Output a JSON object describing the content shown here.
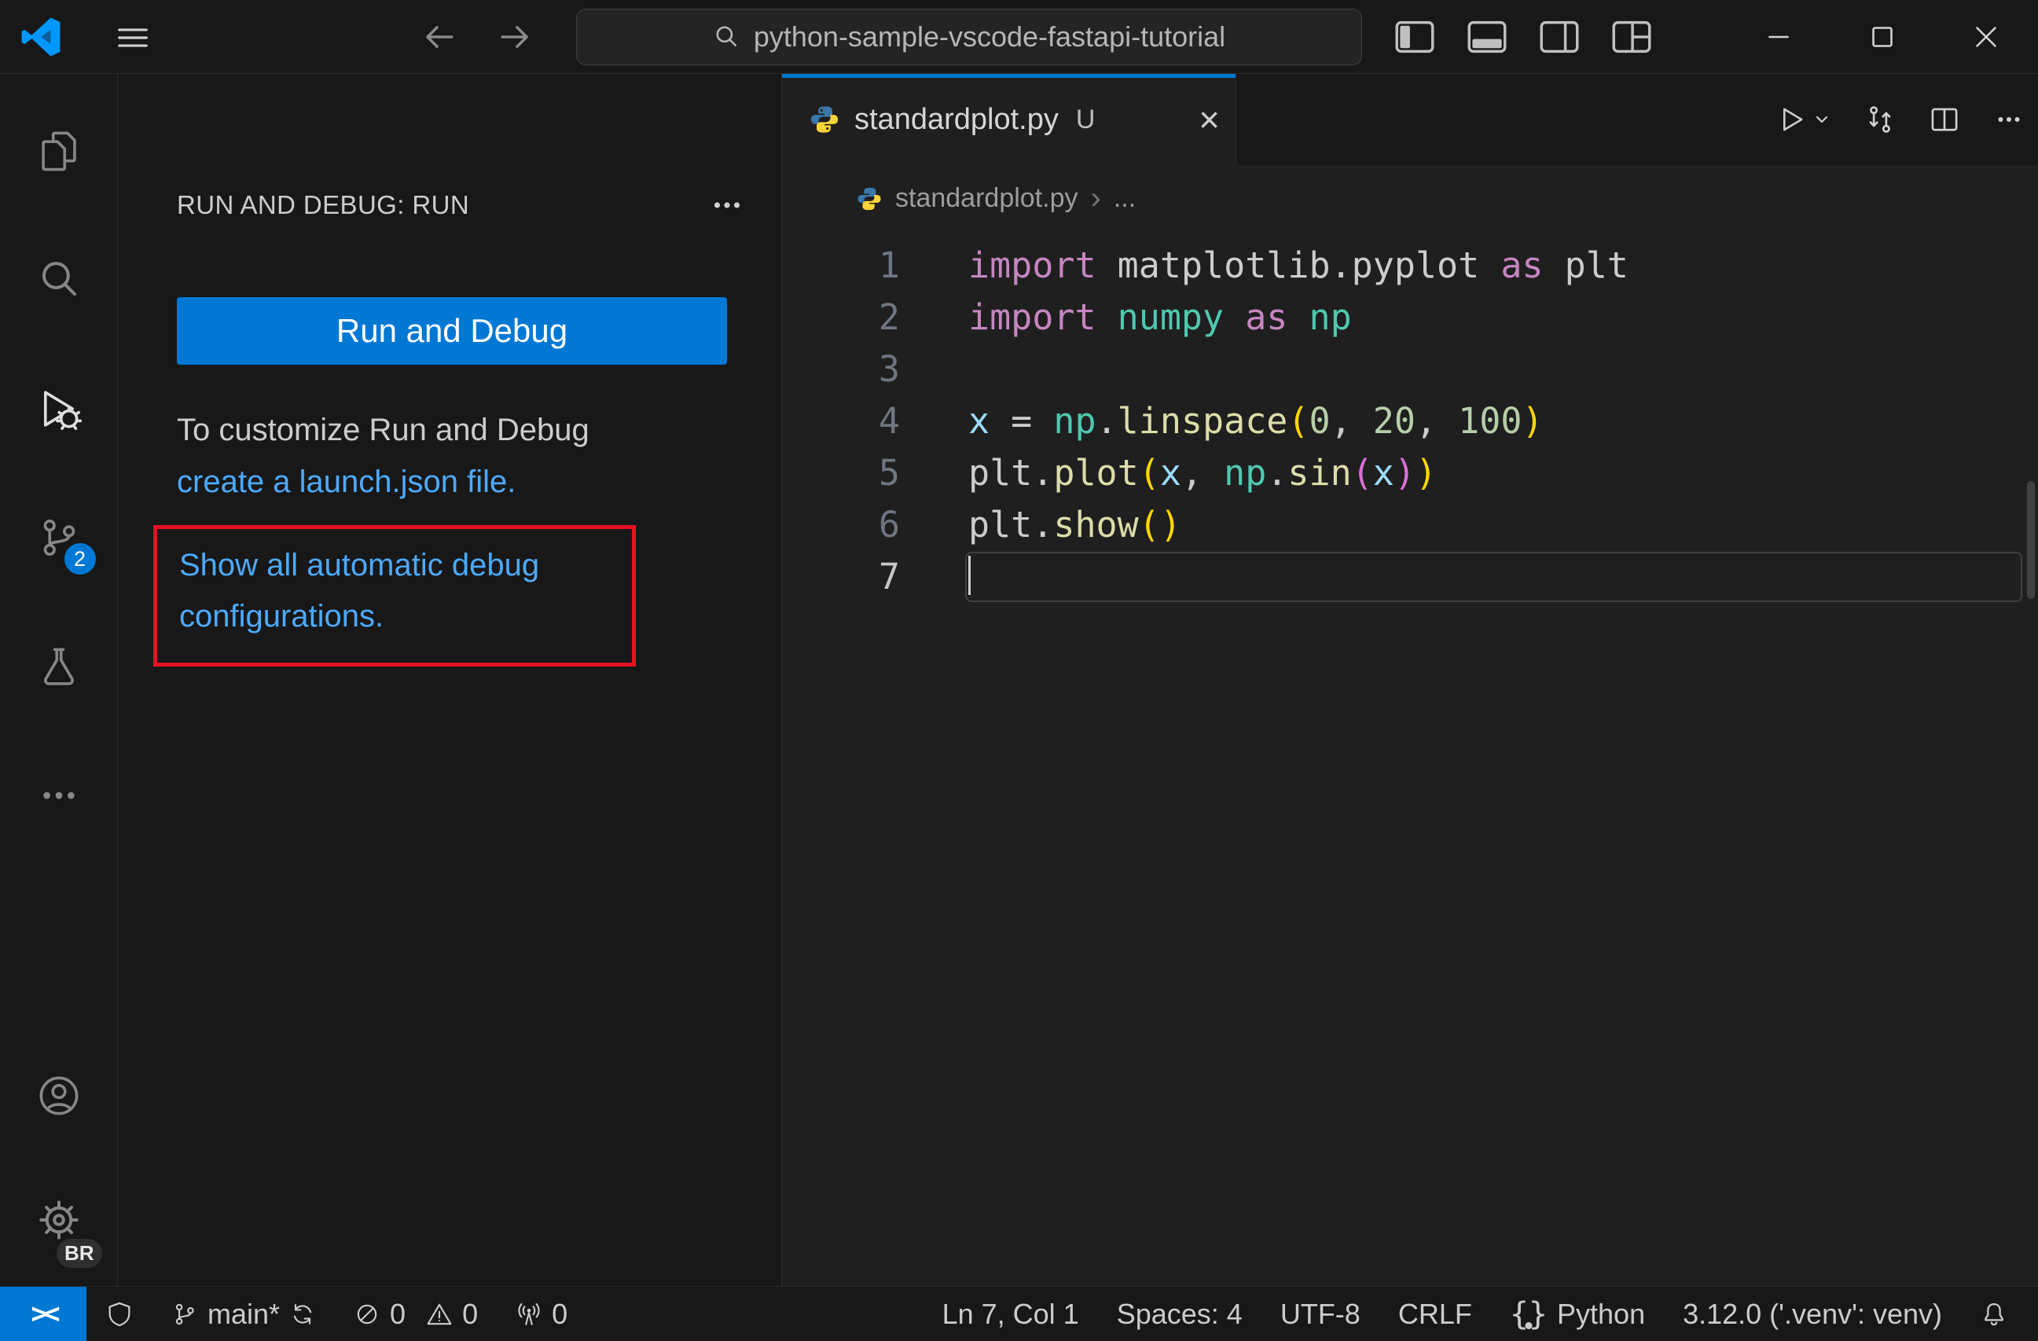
{
  "colors": {
    "accent": "#0078d4",
    "link": "#4daafc",
    "annotation": "#e81123"
  },
  "titlebar": {
    "command_center_text": "python-sample-vscode-fastapi-tutorial"
  },
  "activity_bar": {
    "scm_badge": "2",
    "profile_badge": "BR"
  },
  "sidebar": {
    "header": "RUN AND DEBUG: RUN",
    "run_button_label": "Run and Debug",
    "customize_text": "To customize Run and Debug",
    "customize_link": "create a launch.json file.",
    "show_configs_link": "Show all automatic debug configurations."
  },
  "editor": {
    "tab": {
      "title": "standardplot.py",
      "git_status": "U"
    },
    "breadcrumb": {
      "file": "standardplot.py",
      "more": "..."
    },
    "lines": [
      {
        "n": "1",
        "tokens": [
          {
            "t": "import",
            "c": "kw"
          },
          {
            "t": " matplotlib.pyplot ",
            "c": "fg"
          },
          {
            "t": "as",
            "c": "kw"
          },
          {
            "t": " plt",
            "c": "fg"
          }
        ]
      },
      {
        "n": "2",
        "tokens": [
          {
            "t": "import",
            "c": "kw"
          },
          {
            "t": " numpy ",
            "c": "mod"
          },
          {
            "t": "as",
            "c": "kw"
          },
          {
            "t": " np",
            "c": "mod"
          }
        ]
      },
      {
        "n": "3",
        "tokens": []
      },
      {
        "n": "4",
        "tokens": [
          {
            "t": "x",
            "c": "var"
          },
          {
            "t": " = ",
            "c": "fg"
          },
          {
            "t": "np",
            "c": "mod"
          },
          {
            "t": ".",
            "c": "fg"
          },
          {
            "t": "linspace",
            "c": "fn"
          },
          {
            "t": "(",
            "c": "b1"
          },
          {
            "t": "0",
            "c": "num"
          },
          {
            "t": ", ",
            "c": "fg"
          },
          {
            "t": "20",
            "c": "num"
          },
          {
            "t": ", ",
            "c": "fg"
          },
          {
            "t": "100",
            "c": "num"
          },
          {
            "t": ")",
            "c": "b1"
          }
        ]
      },
      {
        "n": "5",
        "tokens": [
          {
            "t": "plt",
            "c": "fg"
          },
          {
            "t": ".",
            "c": "fg"
          },
          {
            "t": "plot",
            "c": "fn"
          },
          {
            "t": "(",
            "c": "b1"
          },
          {
            "t": "x",
            "c": "var"
          },
          {
            "t": ", ",
            "c": "fg"
          },
          {
            "t": "np",
            "c": "mod"
          },
          {
            "t": ".",
            "c": "fg"
          },
          {
            "t": "sin",
            "c": "fn"
          },
          {
            "t": "(",
            "c": "b2"
          },
          {
            "t": "x",
            "c": "var"
          },
          {
            "t": ")",
            "c": "b2"
          },
          {
            "t": ")",
            "c": "b1"
          }
        ]
      },
      {
        "n": "6",
        "tokens": [
          {
            "t": "plt",
            "c": "fg"
          },
          {
            "t": ".",
            "c": "fg"
          },
          {
            "t": "show",
            "c": "fn"
          },
          {
            "t": "()",
            "c": "b1"
          }
        ]
      },
      {
        "n": "7",
        "tokens": [],
        "cursor": true,
        "active": true
      }
    ]
  },
  "status_bar": {
    "remote_glyph": "><",
    "branch": "main*",
    "errors": "0",
    "warnings": "0",
    "ports": "0",
    "line_col": "Ln 7, Col 1",
    "indent": "Spaces: 4",
    "encoding": "UTF-8",
    "eol": "CRLF",
    "language": "Python",
    "interpreter": "3.12.0 ('.venv': venv)"
  }
}
